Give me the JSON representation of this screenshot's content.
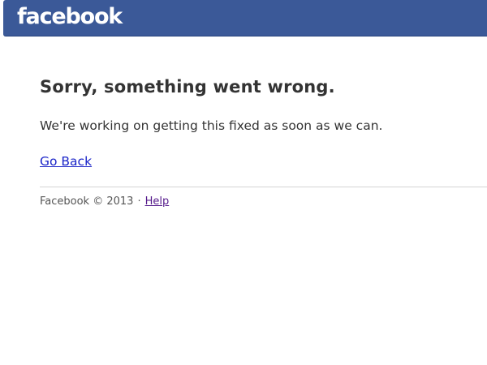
{
  "header": {
    "logo_text": "facebook",
    "background_color": "#3b5998"
  },
  "error": {
    "title": "Sorry, something went wrong.",
    "message": "We're working on getting this fixed as soon as we can.",
    "go_back_label": "Go Back"
  },
  "footer": {
    "copyright": "Facebook © 2013",
    "separator": "·",
    "help_label": "Help"
  },
  "colors": {
    "link": "#1a24c8",
    "visited_link": "#551a8b",
    "text": "#333333"
  }
}
